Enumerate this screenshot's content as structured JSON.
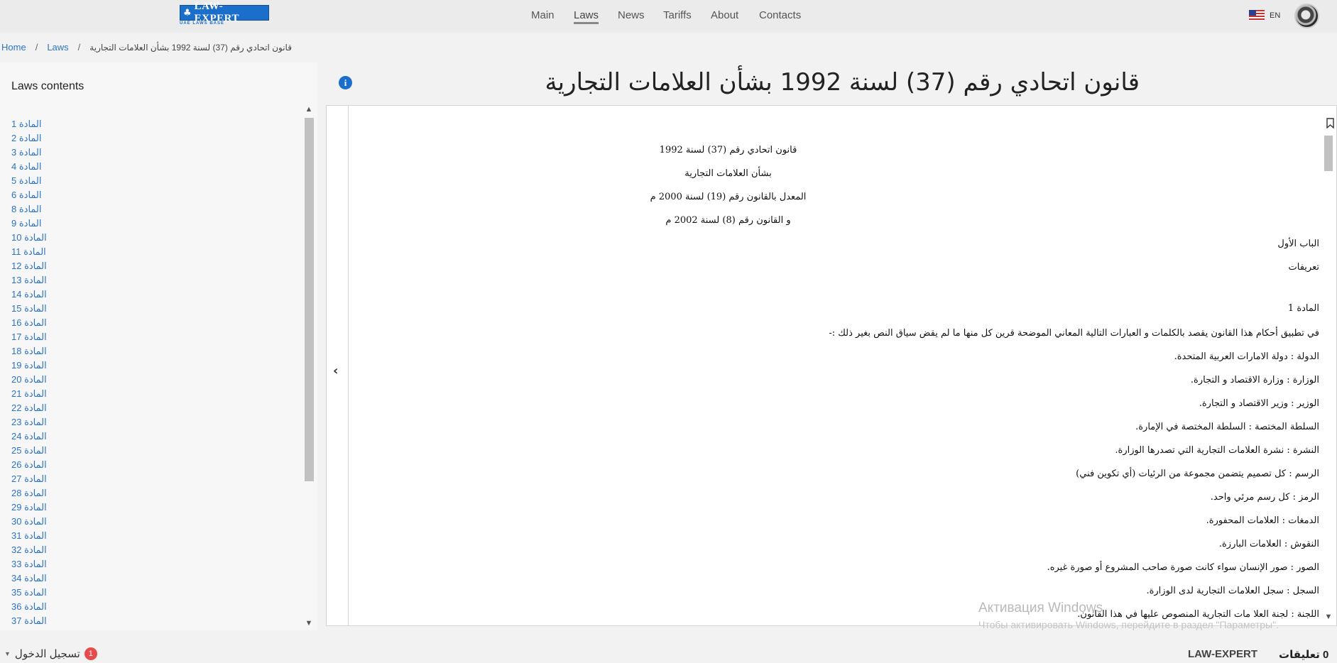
{
  "header": {
    "logo": {
      "name": "LAW-EXPERT",
      "subtitle": "UAE LAWS BASE"
    },
    "nav": [
      {
        "label": "Main",
        "active": false
      },
      {
        "label": "Laws",
        "active": true
      },
      {
        "label": "News",
        "active": false
      },
      {
        "label": "Tariffs",
        "active": false
      },
      {
        "label": "About",
        "active": false
      },
      {
        "label": "Contacts",
        "active": false
      }
    ],
    "language": "EN"
  },
  "breadcrumb": {
    "home": "Home",
    "laws": "Laws",
    "current": "قانون اتحادي رقم (37) لسنة 1992 بشأن العلامات التجارية"
  },
  "sidebar": {
    "title": "Laws contents",
    "items": [
      "المادة 1",
      "المادة 2",
      "المادة  3",
      "المادة 4",
      "المادة 5",
      "المادة 6",
      "المادة 8",
      "المادة 9",
      "المادة 10",
      "المادة 11",
      "المادة 12",
      "المادة 13",
      "المادة 14",
      "المادة 15",
      "المادة 16",
      "المادة 17",
      "المادة 18",
      "المادة 19",
      "المادة 20",
      "المادة 21",
      "المادة 22",
      "المادة 23",
      "المادة 24",
      "المادة 25",
      "المادة 26",
      "المادة 27",
      "المادة 28",
      "المادة 29",
      "المادة 30",
      "المادة 31",
      "المادة 32",
      "المادة 33",
      "المادة 34",
      "المادة 35",
      "المادة 36",
      "المادة 37"
    ]
  },
  "main": {
    "title": "قانون اتحادي رقم (37) لسنة 1992 بشأن العلامات التجارية",
    "document": {
      "heading_lines": [
        "قانون اتحادي رقم (37) لسنة 1992",
        "بشأن العلامات التجارية",
        "المعدل بالقانون رقم (19) لسنة 2000 م",
        "و القانون رقم (8) لسنة 2002 م"
      ],
      "chapter": "الباب الأول",
      "chapter_title": "تعريفات",
      "article": "المادة 1",
      "paragraphs": [
        "في تطبيق أحكام هذا القانون يقصد بالكلمات و العبارات التالية المعاني الموضحة قرين كل منها ما لم يقض سياق النص بغير ذلك :-",
        "الدولة : دولة الامارات العربية المتحدة.",
        "الوزارة : وزارة الاقتصاد و التجارة.",
        "الوزير : وزير الاقتصاد و التجارة.",
        "السلطة المختصة : السلطة المختصة في الإمارة.",
        "النشرة : نشرة العلامات التجارية التي تصدرها الوزارة.",
        "الرسم : كل تصميم يتضمن مجموعة من الرئيات (أي تكوين فني)",
        "الرمز : كل رسم مرئي واحد.",
        "الدمغات : العلامات المحفورة.",
        "النقوش : العلامات البارزة.",
        "الصور : صور الإنسان سواء كانت صورة صاحب المشروع أو صورة غيره.",
        "السجل : سجل العلامات التجارية لدى الوزارة.",
        "اللجنة : لجنة العلا مات التجارية المنصوص عليها في هذا القانون."
      ]
    }
  },
  "watermark": {
    "title": "Активация Windows",
    "text": "Чтобы активировать Windows, перейдите в раздел \"Параметры\"."
  },
  "footer": {
    "login_label": "تسجيل الدخول",
    "login_badge": "1",
    "brand": "LAW-EXPERT",
    "comments": "0 تعليقات"
  }
}
